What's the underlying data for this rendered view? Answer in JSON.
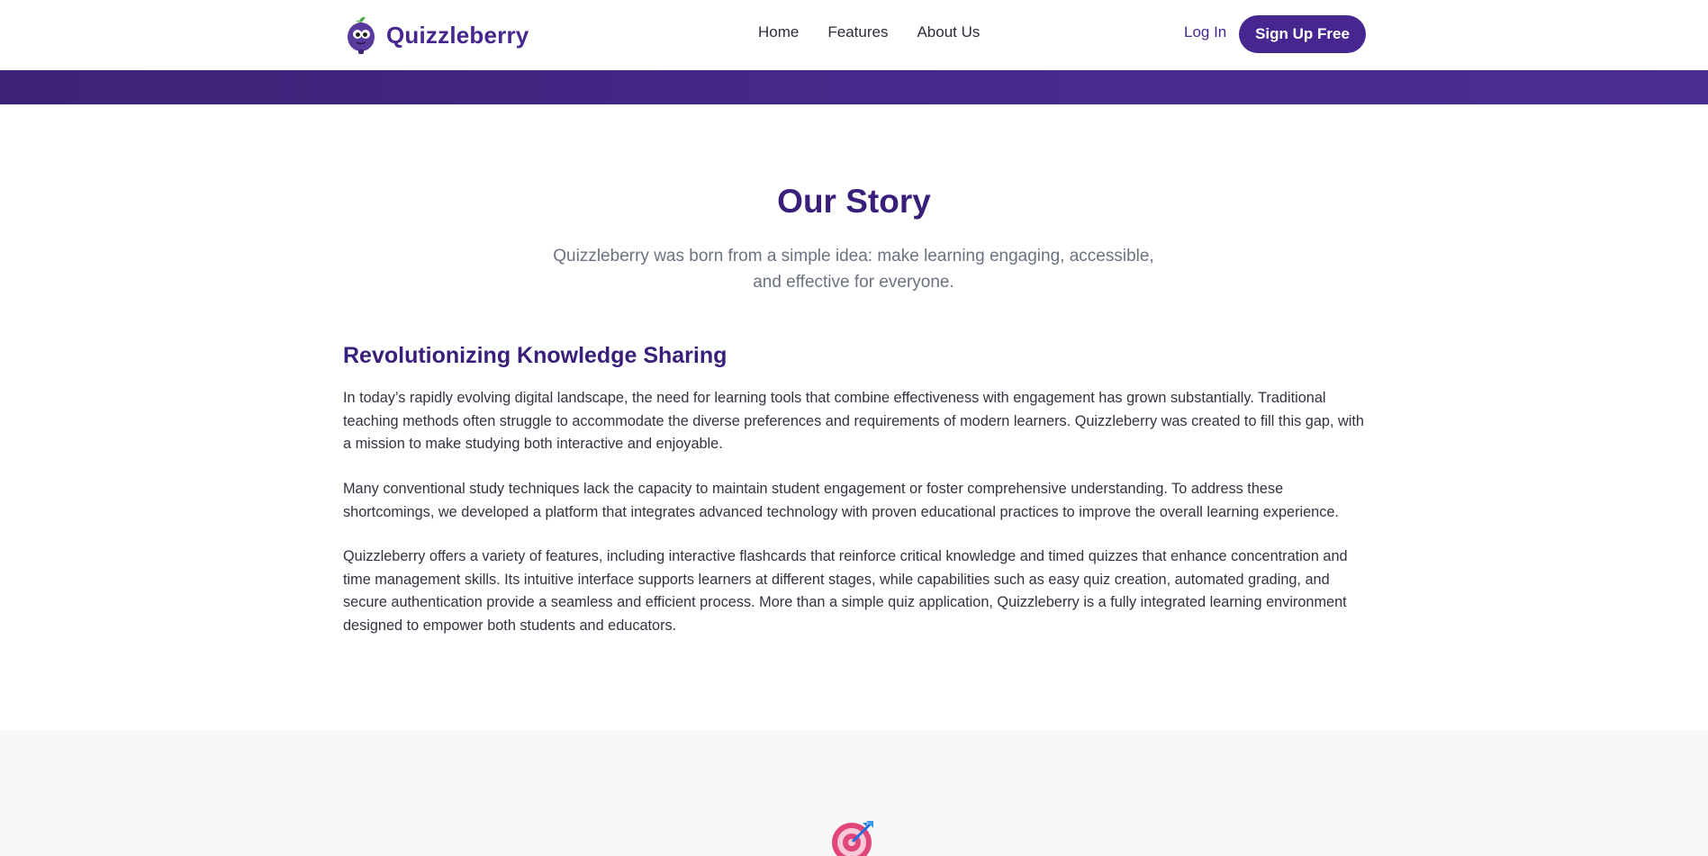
{
  "header": {
    "brand": "Quizzleberry",
    "nav": [
      {
        "label": "Home"
      },
      {
        "label": "Features"
      },
      {
        "label": "About Us"
      }
    ],
    "login_label": "Log In",
    "signup_label": "Sign Up Free"
  },
  "story": {
    "title": "Our Story",
    "subtitle": "Quizzleberry was born from a simple idea: make learning engaging, accessible, and effective for everyone.",
    "section_heading": "Revolutionizing Knowledge Sharing",
    "paragraphs": [
      "In today’s rapidly evolving digital landscape, the need for learning tools that combine effectiveness with engagement has grown substantially. Traditional teaching methods often struggle to accommodate the diverse preferences and requirements of modern learners. Quizzleberry was created to fill this gap, with a mission to make studying both interactive and enjoyable.",
      "Many conventional study techniques lack the capacity to maintain student engagement or foster comprehensive understanding. To address these shortcomings, we developed a platform that integrates advanced technology with proven educational practices to improve the overall learning experience.",
      "Quizzleberry offers a variety of features, including interactive flashcards that reinforce critical knowledge and timed quizzes that enhance concentration and time management skills. Its intuitive interface supports learners at different stages, while capabilities such as easy quiz creation, automated grading, and secure authentication provide a seamless and efficient process. More than a simple quiz application, Quizzleberry is a fully integrated learning environment designed to empower both students and educators."
    ]
  },
  "icons": {
    "logo": "berry-mascot-icon",
    "target": "target-dart-icon"
  },
  "colors": {
    "brand": "#47278f",
    "heading": "#3a1f7a",
    "muted": "#6b7280",
    "band": "#46288a",
    "lower_bg": "#f7f8fa"
  }
}
